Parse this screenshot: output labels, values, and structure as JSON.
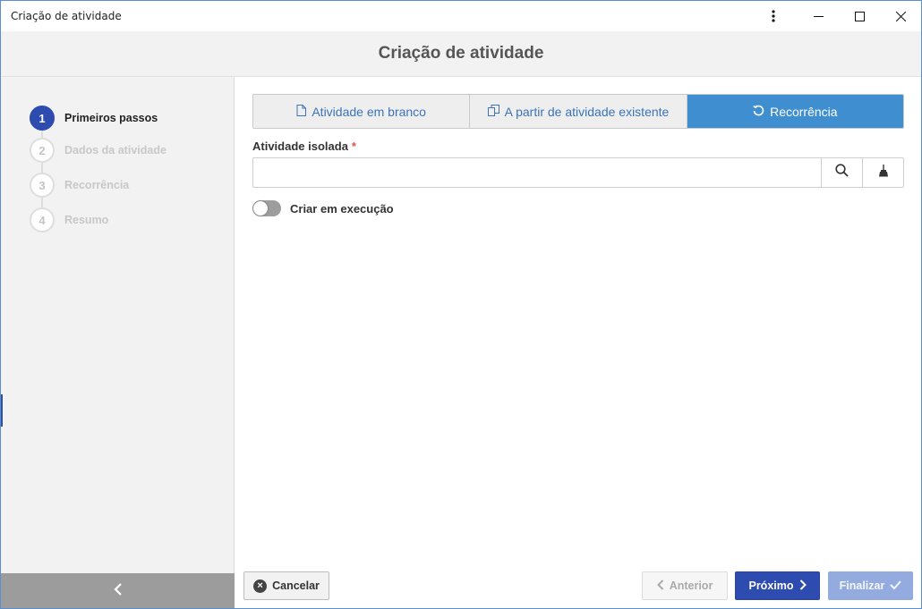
{
  "window": {
    "title": "Criação de atividade"
  },
  "header": {
    "title": "Criação de atividade"
  },
  "steps": [
    {
      "number": "1",
      "label": "Primeiros passos",
      "active": true
    },
    {
      "number": "2",
      "label": "Dados da atividade",
      "active": false
    },
    {
      "number": "3",
      "label": "Recorrência",
      "active": false
    },
    {
      "number": "4",
      "label": "Resumo",
      "active": false
    }
  ],
  "tabs": [
    {
      "label": "Atividade em branco",
      "icon": "file-icon",
      "selected": false
    },
    {
      "label": "A partir de atividade existente",
      "icon": "copy-icon",
      "selected": false
    },
    {
      "label": "Recorrência",
      "icon": "refresh-icon",
      "selected": true
    }
  ],
  "form": {
    "field_label": "Atividade isolada",
    "required_mark": "*",
    "field_value": "",
    "toggle_label": "Criar em execução",
    "toggle_on": false
  },
  "footer": {
    "cancel": "Cancelar",
    "previous": "Anterior",
    "next": "Próximo",
    "finish": "Finalizar"
  },
  "colors": {
    "primary": "#2e4bb0",
    "tab_selected": "#3f8fd0",
    "finish_disabled": "#93abdf",
    "sidebar_bg": "#f2f2f2"
  }
}
